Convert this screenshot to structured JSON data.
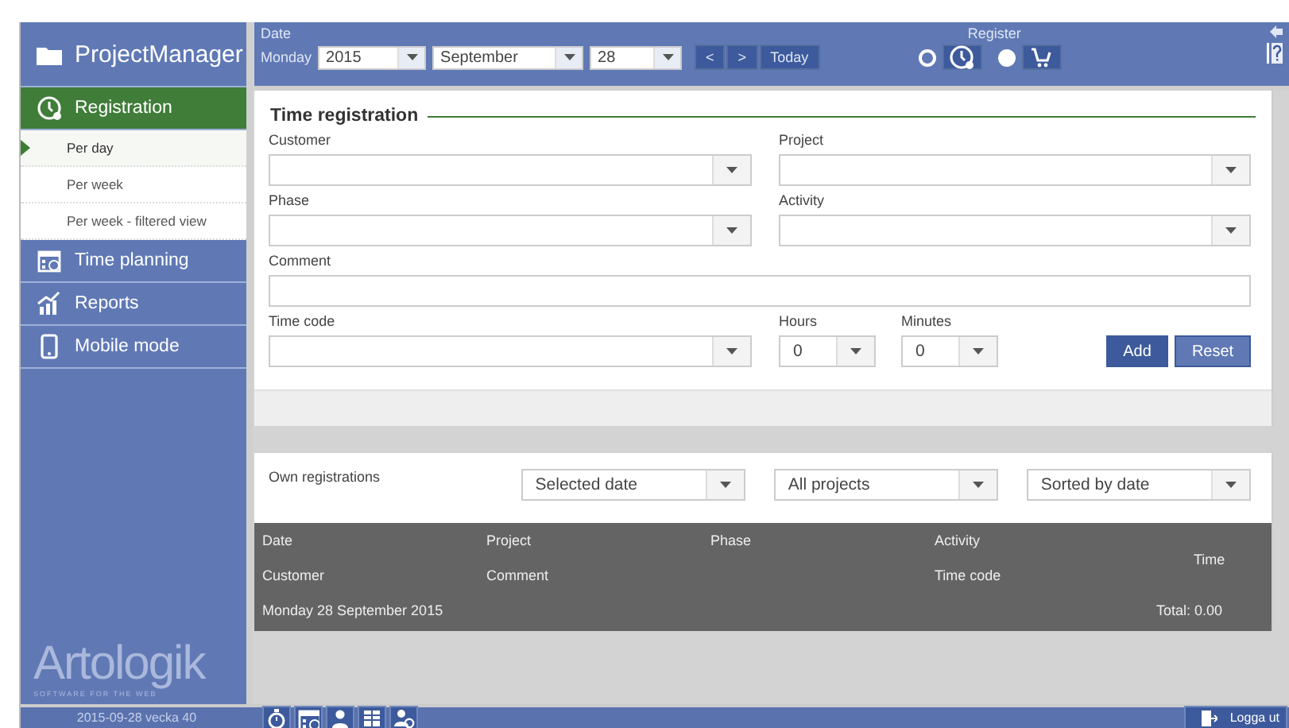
{
  "app_title": "ProjectManager",
  "sidebar": {
    "items": [
      {
        "label": "Registration",
        "selected": true,
        "children": [
          {
            "label": "Per day",
            "selected": true
          },
          {
            "label": "Per week",
            "selected": false
          },
          {
            "label": "Per week - filtered view",
            "selected": false
          }
        ]
      },
      {
        "label": "Time planning",
        "selected": false
      },
      {
        "label": "Reports",
        "selected": false
      },
      {
        "label": "Mobile mode",
        "selected": false
      }
    ],
    "logo": "Artologik",
    "logo_tagline": "SOFTWARE FOR THE WEB",
    "status": "2015-09-28  vecka 40"
  },
  "toolbar": {
    "date_label": "Date",
    "weekday": "Monday",
    "year": "2015",
    "month": "September",
    "day": "28",
    "nav": [
      "<",
      ">",
      "Today"
    ],
    "register_label": "Register",
    "register_modes": [
      {
        "selected": true
      },
      {
        "selected": false
      }
    ]
  },
  "form": {
    "title": "Time registration",
    "fields": [
      {
        "label": "Customer",
        "kind": "select"
      },
      {
        "label": "Project",
        "kind": "select"
      },
      {
        "label": "Phase",
        "kind": "select"
      },
      {
        "label": "Activity",
        "kind": "select"
      },
      {
        "label": "Comment",
        "kind": "text"
      }
    ],
    "time_code": {
      "label": "Time code"
    },
    "hours": {
      "label": "Hours",
      "value": "0"
    },
    "minutes": {
      "label": "Minutes",
      "value": "0"
    },
    "buttons": [
      "Add",
      "Reset"
    ]
  },
  "registrations": {
    "title": "Own registrations",
    "filters": [
      "Selected date",
      "All projects",
      "Sorted by date"
    ],
    "header_rows": [
      [
        "Date",
        "Project",
        "Phase",
        "Activity"
      ],
      [
        "Customer",
        "Comment",
        "",
        "Time code"
      ]
    ],
    "time_header": "Time",
    "date_row": "Monday 28 September 2015",
    "total": "Total: 0.00"
  },
  "footer": {
    "logout": "Logga ut"
  }
}
